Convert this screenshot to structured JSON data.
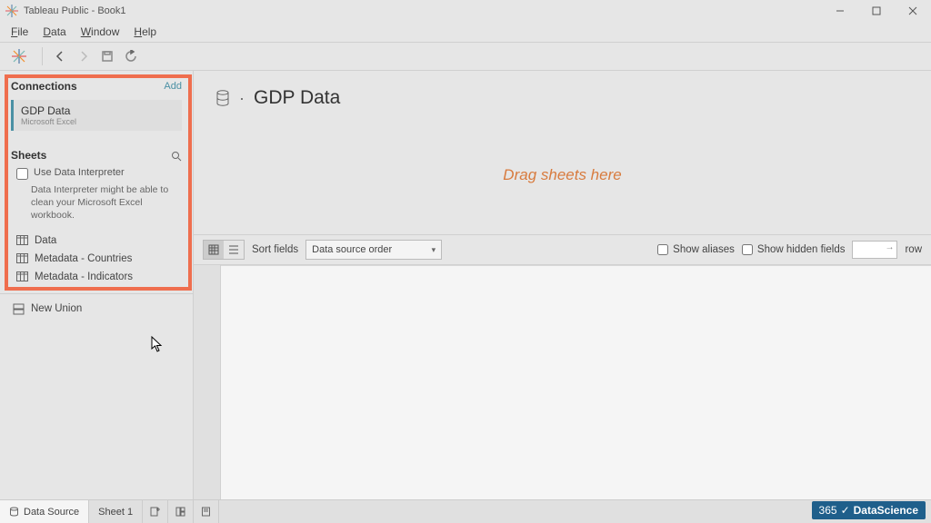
{
  "titlebar": {
    "app_title": "Tableau Public - Book1"
  },
  "menu": {
    "file": "File",
    "data": "Data",
    "window": "Window",
    "help": "Help"
  },
  "sidebar": {
    "connections_title": "Connections",
    "add_link": "Add",
    "connection": {
      "name": "GDP Data",
      "source": "Microsoft Excel"
    },
    "sheets_title": "Sheets",
    "use_interpreter": "Use Data Interpreter",
    "interpreter_help": "Data Interpreter might be able to clean your Microsoft Excel workbook.",
    "sheets": [
      {
        "label": "Data"
      },
      {
        "label": "Metadata - Countries"
      },
      {
        "label": "Metadata - Indicators"
      }
    ],
    "new_union": "New Union"
  },
  "canvas": {
    "datasource_title": "GDP Data",
    "drop_hint": "Drag sheets here",
    "sort_label": "Sort fields",
    "sort_value": "Data source order",
    "show_aliases": "Show aliases",
    "show_hidden": "Show hidden fields",
    "rows_label": "row"
  },
  "tabs": {
    "datasource": "Data Source",
    "sheet1": "Sheet 1"
  },
  "watermark": {
    "prefix": "365",
    "brand": "DataScience"
  }
}
